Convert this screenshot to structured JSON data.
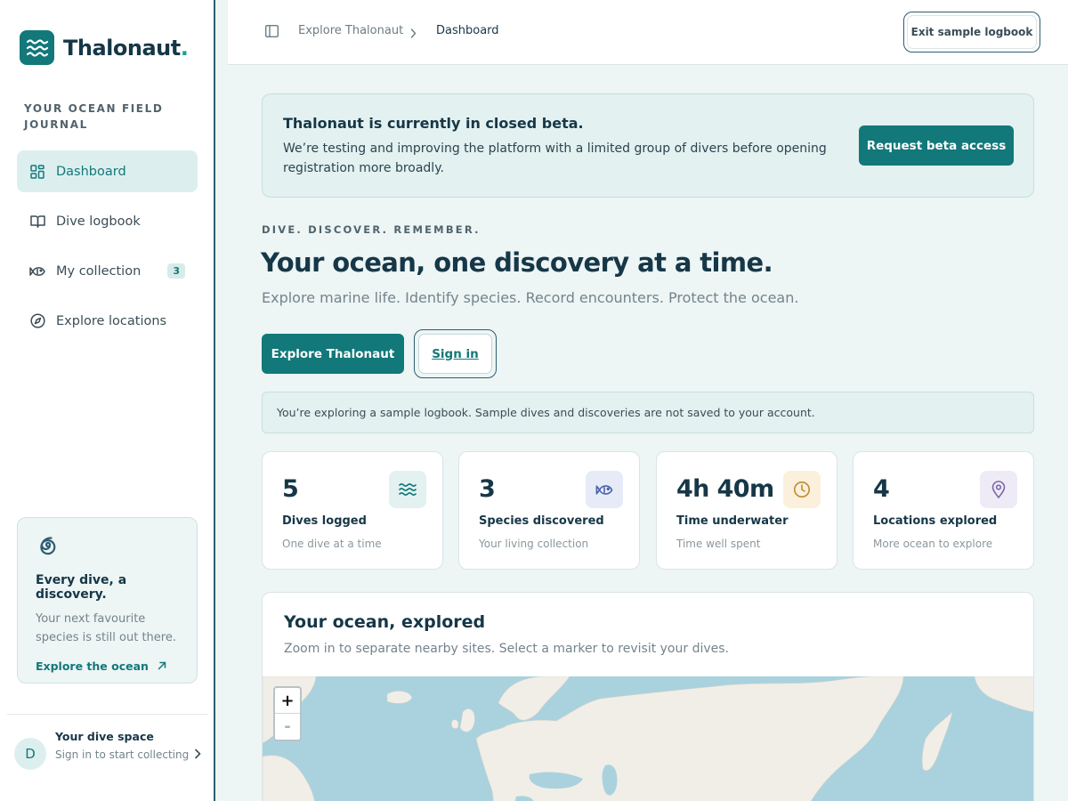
{
  "brand": {
    "name": "Thalonaut",
    "dot": ".",
    "tagline": "YOUR OCEAN FIELD JOURNAL"
  },
  "nav": {
    "items": [
      {
        "label": "Dashboard",
        "icon": "dashboard-icon",
        "active": true
      },
      {
        "label": "Dive logbook",
        "icon": "book-icon"
      },
      {
        "label": "My collection",
        "icon": "fish-icon",
        "badge": "3"
      },
      {
        "label": "Explore locations",
        "icon": "compass-icon"
      }
    ]
  },
  "promo": {
    "title": "Every dive, a discovery.",
    "text": "Your next favourite species is still out there.",
    "link": "Explore the ocean"
  },
  "user": {
    "initial": "D",
    "name": "Your dive space",
    "sub": "Sign in to start collecting"
  },
  "header": {
    "breadcrumb": [
      "Explore Thalonaut",
      "Dashboard"
    ],
    "exit_label": "Exit sample logbook"
  },
  "beta": {
    "title": "Thalonaut is currently in closed beta.",
    "text": "We’re testing and improving the platform with a limited group of divers before opening registration more broadly.",
    "button": "Request beta access"
  },
  "hero": {
    "eyebrow": "DIVE. DISCOVER. REMEMBER.",
    "title": "Your ocean, one discovery at a time.",
    "subtitle": "Explore marine life. Identify species. Record encounters. Protect the ocean.",
    "primary_button": "Explore Thalonaut",
    "secondary_button": "Sign in"
  },
  "sample_note": "You’re exploring a sample logbook. Sample dives and discoveries are not saved to your account.",
  "stats": [
    {
      "value": "5",
      "label": "Dives logged",
      "sub": "One dive at a time",
      "icon": "waves-icon",
      "icon_bg": "#e3f1f0",
      "icon_color": "#12787a"
    },
    {
      "value": "3",
      "label": "Species discovered",
      "sub": "Your living collection",
      "icon": "fish-icon",
      "icon_bg": "#e6ebf7",
      "icon_color": "#4a63a8"
    },
    {
      "value": "4h 40m",
      "label": "Time underwater",
      "sub": "Time well spent",
      "icon": "clock-icon",
      "icon_bg": "#fbf0dc",
      "icon_color": "#c08a2d"
    },
    {
      "value": "4",
      "label": "Locations explored",
      "sub": "More ocean to explore",
      "icon": "map-pin-icon",
      "icon_bg": "#eeebf7",
      "icon_color": "#7a69a8"
    }
  ],
  "map": {
    "title": "Your ocean, explored",
    "subtitle": "Zoom in to separate nearby sites. Select a marker to revisit your dives.",
    "zoom_in": "+",
    "zoom_out": "-",
    "land_color": "#f1eee8",
    "water_color": "#a9d2de"
  }
}
